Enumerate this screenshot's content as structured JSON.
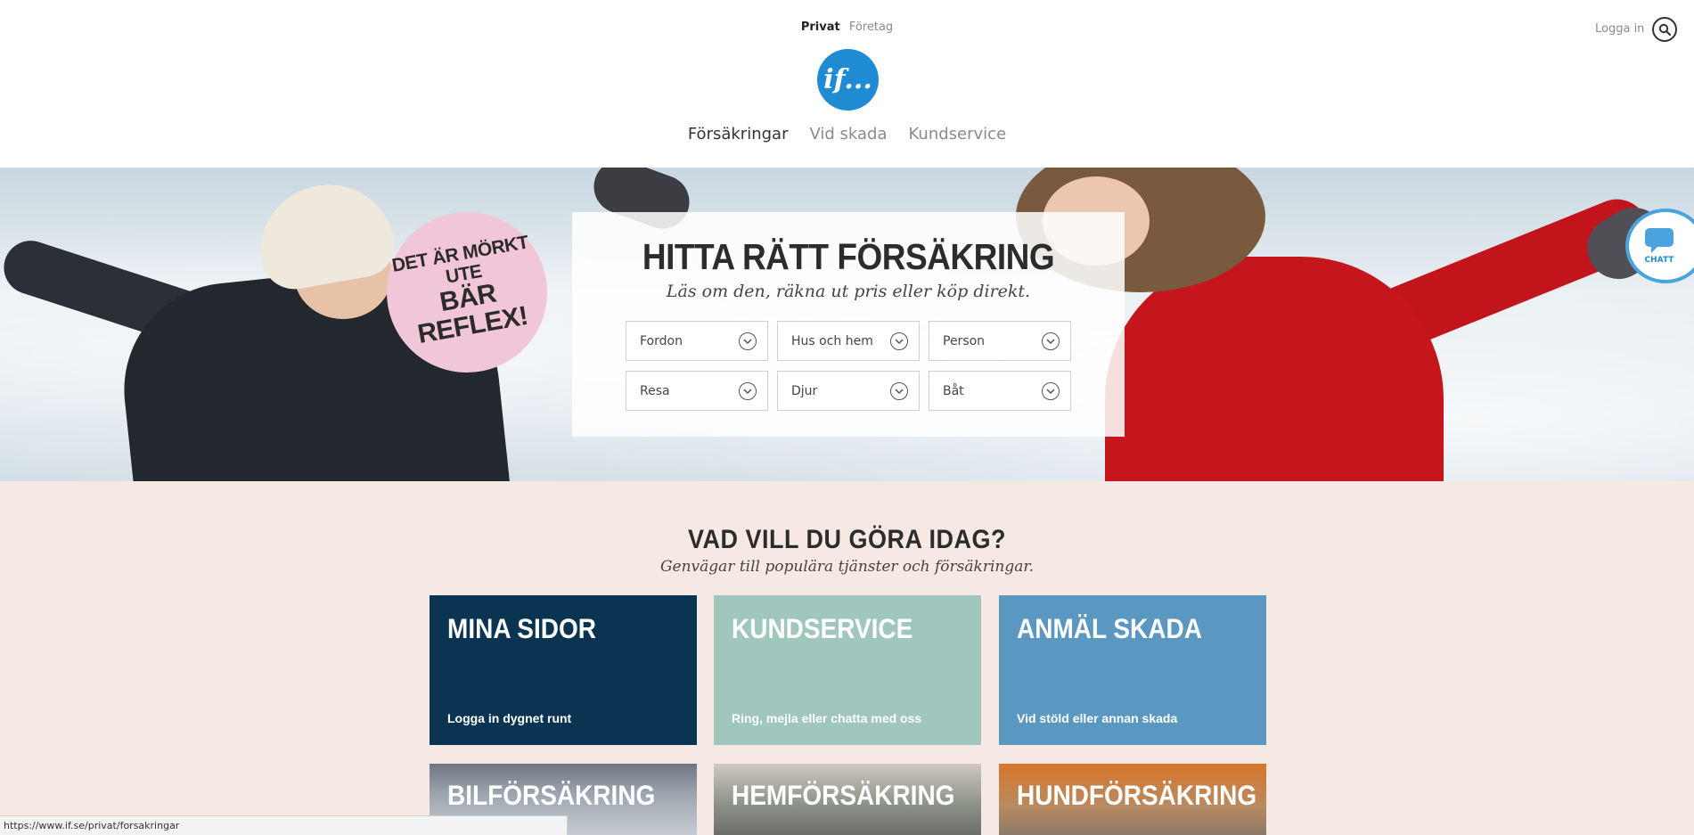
{
  "header": {
    "segments": [
      {
        "label": "Privat",
        "active": true
      },
      {
        "label": "Företag",
        "active": false
      }
    ],
    "login_label": "Logga in",
    "logo_text": "if...",
    "nav": [
      {
        "label": "Försäkringar",
        "active": true
      },
      {
        "label": "Vid skada",
        "active": false
      },
      {
        "label": "Kundservice",
        "active": false
      }
    ]
  },
  "hero": {
    "badge_line1": "DET ÄR MÖRKT UTE",
    "badge_line2": "BÄR REFLEX!",
    "finder_title": "HITTA RÄTT FÖRSÄKRING",
    "finder_subtitle": "Läs om den, räkna ut pris eller köp direkt.",
    "selects": [
      "Fordon",
      "Hus och hem",
      "Person",
      "Resa",
      "Djur",
      "Båt"
    ],
    "chat_label": "CHATT"
  },
  "shortcuts": {
    "title": "VAD VILL DU GÖRA IDAG?",
    "subtitle": "Genvägar till populära tjänster och försäkringar.",
    "cards": [
      {
        "title": "MINA SIDOR",
        "text": "Logga in dygnet runt"
      },
      {
        "title": "KUNDSERVICE",
        "text": "Ring, mejla eller chatta med oss"
      },
      {
        "title": "ANMÄL SKADA",
        "text": "Vid stöld eller annan skada"
      }
    ],
    "tiles": [
      "BILFÖRSÄKRING",
      "HEMFÖRSÄKRING",
      "HUNDFÖRSÄKRING"
    ]
  },
  "status_url": "https://www.if.se/privat/forsakringar",
  "colors": {
    "brand_blue": "#1e8bd3",
    "card_navy": "#0b3453",
    "card_mint": "#a0c7bd",
    "card_blue": "#5b98c1",
    "shortcuts_bg": "#f6e9e3",
    "badge_pink": "#f1c6d8"
  }
}
